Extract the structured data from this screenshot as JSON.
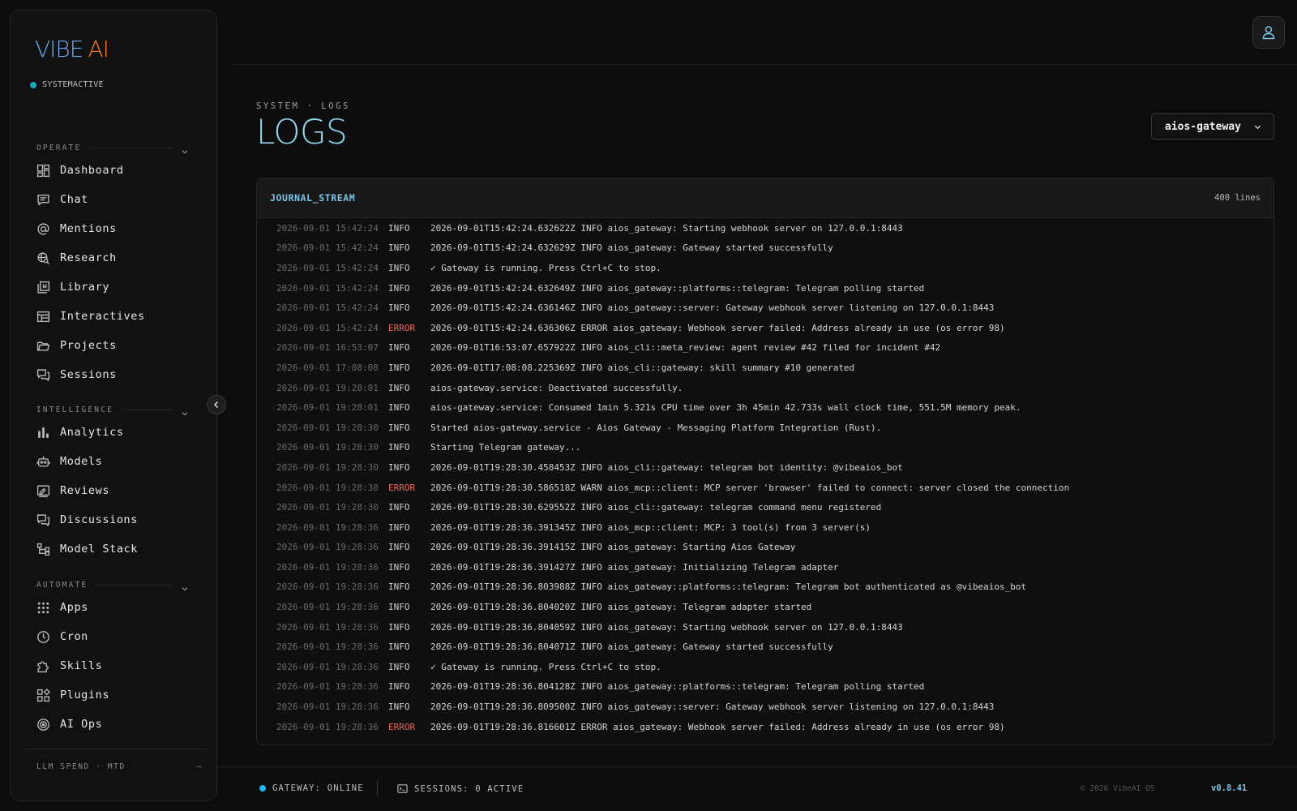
{
  "brand": {
    "logo_main": "VIBE",
    "logo_accent": "AI",
    "system_status": "SYSTEMACTIVE",
    "colors": {
      "logo_main": "#6aa9f0",
      "logo_accent": "#f07a2a",
      "status_dot": "#1aa6b7"
    }
  },
  "sidebar": {
    "sections": [
      {
        "label": "OPERATE",
        "items": [
          {
            "label": "Dashboard",
            "icon": "dashboard-icon"
          },
          {
            "label": "Chat",
            "icon": "chat-icon"
          },
          {
            "label": "Mentions",
            "icon": "at-sign-icon"
          },
          {
            "label": "Research",
            "icon": "research-icon"
          },
          {
            "label": "Library",
            "icon": "library-icon"
          },
          {
            "label": "Interactives",
            "icon": "layout-icon"
          },
          {
            "label": "Projects",
            "icon": "folder-icon"
          },
          {
            "label": "Sessions",
            "icon": "sessions-icon"
          }
        ]
      },
      {
        "label": "INTELLIGENCE",
        "items": [
          {
            "label": "Analytics",
            "icon": "bar-chart-icon"
          },
          {
            "label": "Models",
            "icon": "robot-icon"
          },
          {
            "label": "Reviews",
            "icon": "review-icon"
          },
          {
            "label": "Discussions",
            "icon": "discussions-icon"
          },
          {
            "label": "Model Stack",
            "icon": "stack-icon"
          }
        ]
      },
      {
        "label": "AUTOMATE",
        "items": [
          {
            "label": "Apps",
            "icon": "apps-grid-icon"
          },
          {
            "label": "Cron",
            "icon": "clock-icon"
          },
          {
            "label": "Skills",
            "icon": "puzzle-icon"
          },
          {
            "label": "Plugins",
            "icon": "plugins-icon"
          },
          {
            "label": "AI Ops",
            "icon": "target-icon"
          }
        ]
      }
    ],
    "spend_label": "LLM SPEND · MTD",
    "spend_value": "—"
  },
  "header": {
    "breadcrumb": "SYSTEM · LOGS",
    "title": "LOGS",
    "service_select": "aios-gateway",
    "title_color": "#8fd6f0"
  },
  "journal": {
    "title": "JOURNAL_STREAM",
    "line_count": "400 lines",
    "rows": [
      {
        "ts": "2026-09-01 15:42:24",
        "level": "INFO",
        "msg": "2026-09-01T15:42:24.632622Z INFO aios_gateway: Starting webhook server on 127.0.0.1:8443"
      },
      {
        "ts": "2026-09-01 15:42:24",
        "level": "INFO",
        "msg": "2026-09-01T15:42:24.632629Z INFO aios_gateway: Gateway started successfully"
      },
      {
        "ts": "2026-09-01 15:42:24",
        "level": "INFO",
        "msg": "✓ Gateway is running. Press Ctrl+C to stop."
      },
      {
        "ts": "2026-09-01 15:42:24",
        "level": "INFO",
        "msg": "2026-09-01T15:42:24.632649Z INFO aios_gateway::platforms::telegram: Telegram polling started"
      },
      {
        "ts": "2026-09-01 15:42:24",
        "level": "INFO",
        "msg": "2026-09-01T15:42:24.636146Z INFO aios_gateway::server: Gateway webhook server listening on 127.0.0.1:8443"
      },
      {
        "ts": "2026-09-01 15:42:24",
        "level": "ERROR",
        "msg": "2026-09-01T15:42:24.636306Z ERROR aios_gateway: Webhook server failed: Address already in use (os error 98)"
      },
      {
        "ts": "2026-09-01 16:53:07",
        "level": "INFO",
        "msg": "2026-09-01T16:53:07.657922Z INFO aios_cli::meta_review: agent review #42 filed for incident #42"
      },
      {
        "ts": "2026-09-01 17:08:08",
        "level": "INFO",
        "msg": "2026-09-01T17:08:08.225369Z INFO aios_cli::gateway: skill summary #10 generated"
      },
      {
        "ts": "2026-09-01 19:28:01",
        "level": "INFO",
        "msg": "aios-gateway.service: Deactivated successfully."
      },
      {
        "ts": "2026-09-01 19:28:01",
        "level": "INFO",
        "msg": "aios-gateway.service: Consumed 1min 5.321s CPU time over 3h 45min 42.733s wall clock time, 551.5M memory peak."
      },
      {
        "ts": "2026-09-01 19:28:30",
        "level": "INFO",
        "msg": "Started aios-gateway.service - Aios Gateway - Messaging Platform Integration (Rust)."
      },
      {
        "ts": "2026-09-01 19:28:30",
        "level": "INFO",
        "msg": "Starting Telegram gateway..."
      },
      {
        "ts": "2026-09-01 19:28:30",
        "level": "INFO",
        "msg": "2026-09-01T19:28:30.458453Z INFO aios_cli::gateway: telegram bot identity: @vibeaios_bot"
      },
      {
        "ts": "2026-09-01 19:28:30",
        "level": "ERROR",
        "msg": "2026-09-01T19:28:30.586518Z WARN aios_mcp::client: MCP server 'browser' failed to connect: server closed the connection"
      },
      {
        "ts": "2026-09-01 19:28:30",
        "level": "INFO",
        "msg": "2026-09-01T19:28:30.629552Z INFO aios_cli::gateway: telegram command menu registered"
      },
      {
        "ts": "2026-09-01 19:28:36",
        "level": "INFO",
        "msg": "2026-09-01T19:28:36.391345Z INFO aios_mcp::client: MCP: 3 tool(s) from 3 server(s)"
      },
      {
        "ts": "2026-09-01 19:28:36",
        "level": "INFO",
        "msg": "2026-09-01T19:28:36.391415Z INFO aios_gateway: Starting Aios Gateway"
      },
      {
        "ts": "2026-09-01 19:28:36",
        "level": "INFO",
        "msg": "2026-09-01T19:28:36.391427Z INFO aios_gateway: Initializing Telegram adapter"
      },
      {
        "ts": "2026-09-01 19:28:36",
        "level": "INFO",
        "msg": "2026-09-01T19:28:36.803988Z INFO aios_gateway::platforms::telegram: Telegram bot authenticated as @vibeaios_bot"
      },
      {
        "ts": "2026-09-01 19:28:36",
        "level": "INFO",
        "msg": "2026-09-01T19:28:36.804020Z INFO aios_gateway: Telegram adapter started"
      },
      {
        "ts": "2026-09-01 19:28:36",
        "level": "INFO",
        "msg": "2026-09-01T19:28:36.804059Z INFO aios_gateway: Starting webhook server on 127.0.0.1:8443"
      },
      {
        "ts": "2026-09-01 19:28:36",
        "level": "INFO",
        "msg": "2026-09-01T19:28:36.804071Z INFO aios_gateway: Gateway started successfully"
      },
      {
        "ts": "2026-09-01 19:28:36",
        "level": "INFO",
        "msg": "✓ Gateway is running. Press Ctrl+C to stop."
      },
      {
        "ts": "2026-09-01 19:28:36",
        "level": "INFO",
        "msg": "2026-09-01T19:28:36.804128Z INFO aios_gateway::platforms::telegram: Telegram polling started"
      },
      {
        "ts": "2026-09-01 19:28:36",
        "level": "INFO",
        "msg": "2026-09-01T19:28:36.809500Z INFO aios_gateway::server: Gateway webhook server listening on 127.0.0.1:8443"
      },
      {
        "ts": "2026-09-01 19:28:36",
        "level": "ERROR",
        "msg": "2026-09-01T19:28:36.816601Z ERROR aios_gateway: Webhook server failed: Address already in use (os error 98)"
      }
    ],
    "colors": {
      "error": "#e86a5a",
      "title": "#7cc3e8"
    }
  },
  "footer": {
    "gateway_status": "GATEWAY: ONLINE",
    "sessions_status": "SESSIONS: 0 ACTIVE",
    "copyright": "© 2026 VibeAI OS",
    "version": "v0.8.41",
    "colors": {
      "gateway_dot": "#22b8e8",
      "version": "#7cc3e8"
    }
  }
}
